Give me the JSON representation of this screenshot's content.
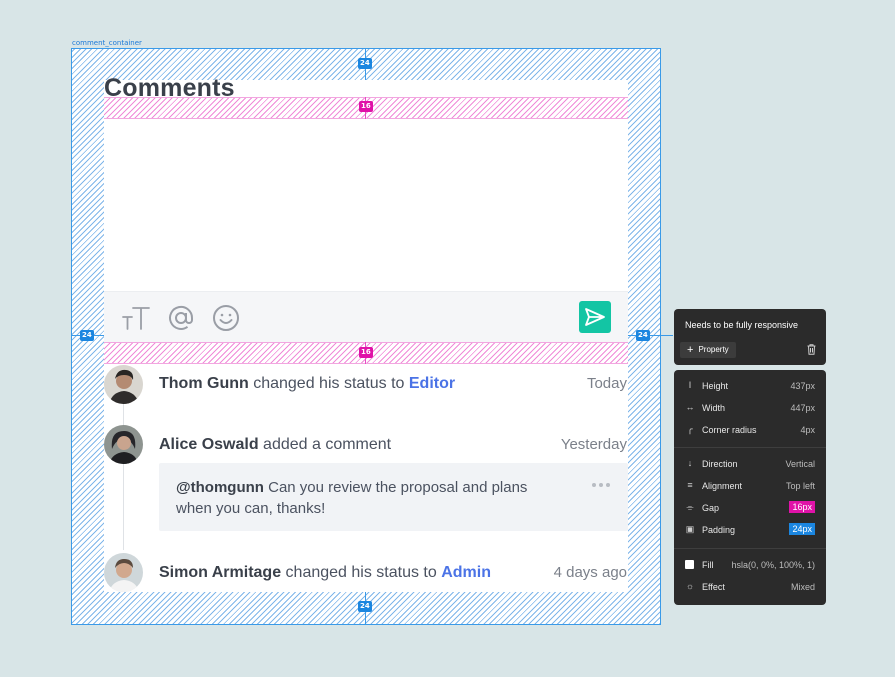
{
  "canvas": {
    "container_label": "comment_container",
    "padding_badge": "24",
    "gap_badge": "16"
  },
  "comments": {
    "title": "Comments",
    "toolbar": {
      "text_format_icon": "text-format-icon",
      "mention_icon": "at-sign-icon",
      "emoji_icon": "smiley-icon",
      "send_icon": "send-icon"
    },
    "entries": [
      {
        "name": "Thom Gunn",
        "action": " changed his status to ",
        "role": "Editor",
        "time": "Today"
      },
      {
        "name": "Alice Oswald",
        "action": " added a comment",
        "time": "Yesterday",
        "comment": {
          "mention": "@thomgunn",
          "text": " Can you review the proposal and plans when you can, thanks!"
        }
      },
      {
        "name": "Simon Armitage",
        "action": " changed his status to ",
        "role": "Admin",
        "time": "4 days ago"
      }
    ]
  },
  "tooltip": {
    "message": "Needs to be fully responsive",
    "property_label": "Property"
  },
  "properties": [
    {
      "label": "Height",
      "value": "437px"
    },
    {
      "label": "Width",
      "value": "447px"
    },
    {
      "label": "Corner radius",
      "value": "4px"
    },
    {
      "label": "Direction",
      "value": "Vertical"
    },
    {
      "label": "Alignment",
      "value": "Top left"
    },
    {
      "label": "Gap",
      "value": "16px"
    },
    {
      "label": "Padding",
      "value": "24px"
    },
    {
      "label": "Fill",
      "value": "hsla(0, 0%, 100%, 1)"
    },
    {
      "label": "Effect",
      "value": "Mixed"
    }
  ],
  "colors": {
    "accent_blue": "#1b86e0",
    "accent_pink": "#e012a8",
    "send_green": "#13c5a4",
    "role_link": "#4b73e6"
  }
}
